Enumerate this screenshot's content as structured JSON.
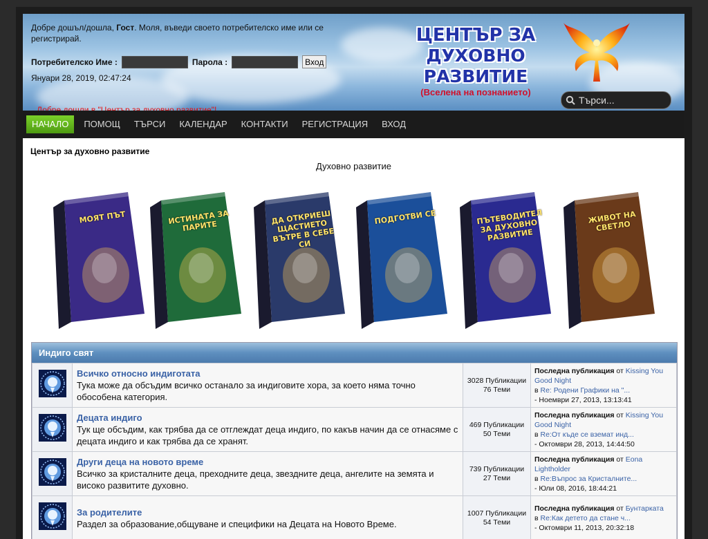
{
  "header": {
    "welcome_prefix": "Добре дошъл/дошла,",
    "guest": "Гост",
    "welcome_suffix": ". Моля, въведи своето потребителско име или се регистрирай.",
    "username_label": "Потребителско Име :",
    "password_label": "Парола :",
    "login_button": "Вход",
    "date": "Януари 28, 2019, 02:47:24",
    "greeting": "Добре дошли в \"Център за духовно развитие\"!",
    "logo_line1": "ЦЕНТЪР ЗА",
    "logo_line2": "ДУХОВНО РАЗВИТИЕ",
    "logo_line3": "(Вселена на познанието)",
    "search_placeholder": "Търси..."
  },
  "nav": {
    "items": [
      "НАЧАЛО",
      "ПОМОЩ",
      "ТЪРСИ",
      "КАЛЕНДАР",
      "КОНТАКТИ",
      "РЕГИСТРАЦИЯ",
      "ВХОД"
    ],
    "active_index": 0
  },
  "main": {
    "board_title": "Център за духовно развитие",
    "subtitle": "Духовно развитие",
    "books": [
      {
        "title": "МОЯТ ПЪТ",
        "color": "#3a2a86"
      },
      {
        "title": "ИСТИНАТА ЗА ПАРИТЕ",
        "color": "#1f6b3a"
      },
      {
        "title": "ДА ОТКРИЕШ ЩАСТИЕТО ВЪТРЕ В СЕБЕ СИ",
        "color": "#2a3a6a"
      },
      {
        "title": "ПОДГОТВИ СЕ",
        "color": "#1b4f9a"
      },
      {
        "title": "ПЪТЕВОДИТЕЛ ЗА ДУХОВНО РАЗВИТИЕ",
        "color": "#2a2a90"
      },
      {
        "title": "ЖИВОТ НА СВЕТЛО",
        "color": "#6a3a1a"
      }
    ]
  },
  "category": {
    "name": "Индиго свят",
    "boards": [
      {
        "title": "Всичко относно индиготата",
        "desc": "Тука може да обсъдим всичко останало за индиговите хора, за което няма точно обособена категория.",
        "posts": "3028 Публикации",
        "topics": "76 Теми",
        "last_label": "Последна публикация",
        "by": "от",
        "author": "Kissing You Good Night",
        "in": "в",
        "topic": "Re: Родени Графики на \"...",
        "date": "- Ноември 27, 2013, 13:13:41"
      },
      {
        "title": "Децата индиго",
        "desc": "Тук ще обсъдим, как трябва да се отглеждат деца индиго, по какъв начин да се отнасяме с децата индиго и как трябва да се хранят.",
        "posts": "469 Публикации",
        "topics": "50 Теми",
        "last_label": "Последна публикация",
        "by": "от",
        "author": "Kissing You Good Night",
        "in": "в",
        "topic": "Re:От къде се вземат инд...",
        "date": "- Октомври 28, 2013, 14:44:50"
      },
      {
        "title": "Други деца на новото време",
        "desc": "Всичко за кристалните деца, преходните деца, звездните деца, ангелите на земята и високо развитите духовно.",
        "posts": "739 Публикации",
        "topics": "27 Теми",
        "last_label": "Последна публикация",
        "by": "от",
        "author": "Eona Lightholder",
        "in": "в",
        "topic": "Re:Въпрос за Кристалните...",
        "date": "- Юли 08, 2016, 18:44:21"
      },
      {
        "title": "За родителите",
        "desc": "Раздел за образование,общуване и специфики на Децата на Новото Време.",
        "posts": "1007 Публикации",
        "topics": "54 Теми",
        "last_label": "Последна публикация",
        "by": "от",
        "author": "Бунтарката",
        "in": "в",
        "topic": "Re:Как детето да стане ч...",
        "date": "- Октомври 11, 2013, 20:32:18"
      }
    ]
  }
}
